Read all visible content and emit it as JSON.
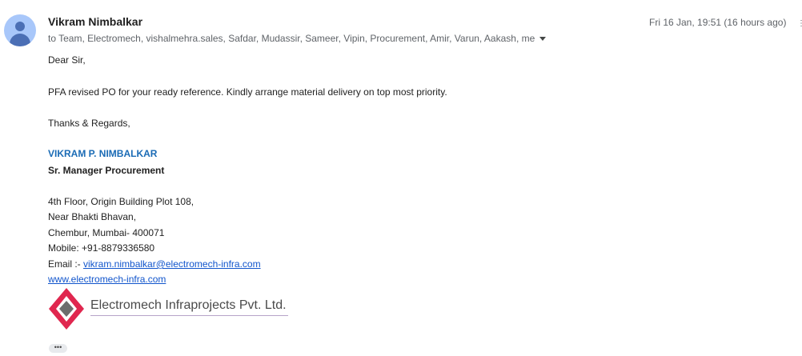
{
  "sender": {
    "name": "Vikram Nimbalkar"
  },
  "recipients": {
    "text": "to Team, Electromech, vishalmehra.sales, Safdar, Mudassir, Sameer, Vipin, Procurement, Amir, Varun, Aakash, me"
  },
  "date": {
    "text": "Fri 16 Jan, 19:51 (16 hours ago)"
  },
  "body": {
    "greeting": "Dear Sir,",
    "message": "PFA revised PO for your ready reference. Kindly arrange material delivery on top most priority.",
    "closing": "Thanks & Regards,"
  },
  "signature": {
    "name": "VIKRAM P. NIMBALKAR",
    "title": "Sr. Manager Procurement",
    "address_1": "4th Floor, Origin Building Plot 108,",
    "address_2": "Near Bhakti Bhavan,",
    "address_3": "Chembur, Mumbai- 400071",
    "mobile": "Mobile: +91-8879336580",
    "email_label": "Email :- ",
    "email": "vikram.nimbalkar@electromech-infra.com",
    "website": "www.electromech-infra.com"
  },
  "logo": {
    "company": "Electromech Infraprojects Pvt. Ltd."
  },
  "actions": {
    "show_trimmed": "•••"
  },
  "icons": {
    "avatar": "person-avatar-icon",
    "caret": "caret-down-icon",
    "edge": "more-options-icon"
  },
  "colors": {
    "signature_name": "#1a6bb5",
    "link": "#1155cc",
    "logo_red": "#e0274f"
  }
}
